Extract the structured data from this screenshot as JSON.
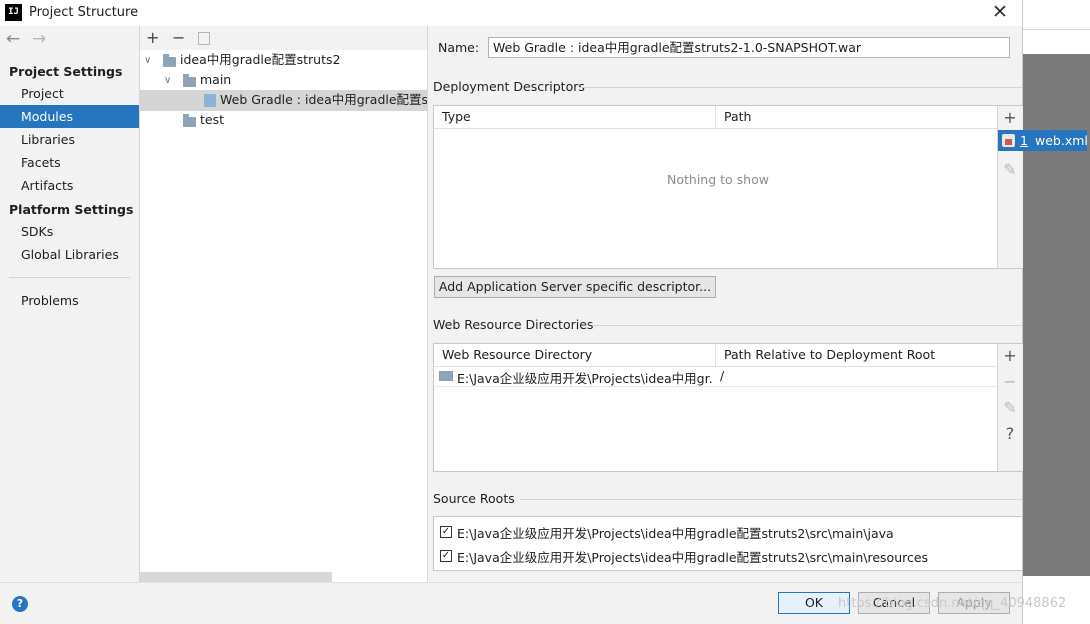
{
  "window": {
    "title": "Project Structure",
    "logo": "IJ"
  },
  "nav": {
    "back_icon": "arrow-left-icon",
    "forward_icon": "arrow-right-icon",
    "project_settings_header": "Project Settings",
    "project_items": [
      "Project",
      "Modules",
      "Libraries",
      "Facets",
      "Artifacts"
    ],
    "platform_settings_header": "Platform Settings",
    "platform_items": [
      "SDKs",
      "Global Libraries"
    ],
    "problems": "Problems",
    "selected": "Modules"
  },
  "tree": {
    "toolbar": {
      "add": "+",
      "remove": "−"
    },
    "root": "idea中用gradle配置struts2",
    "main": "main",
    "facet": "Web Gradle : idea中用gradle配置str",
    "test": "test"
  },
  "detail": {
    "name_label": "Name:",
    "name_value": "Web Gradle : idea中用gradle配置struts2-1.0-SNAPSHOT.war",
    "deployment_descriptors": {
      "header": "Deployment Descriptors",
      "columns": [
        "Type",
        "Path"
      ],
      "empty_text": "Nothing to show",
      "add_button": "Add Application Server specific descriptor..."
    },
    "popup": {
      "number": "1",
      "label": "web.xml"
    },
    "web_resource": {
      "header": "Web Resource Directories",
      "columns": [
        "Web Resource Directory",
        "Path Relative to Deployment Root"
      ],
      "rows": [
        {
          "dir": "E:\\Java企业级应用开发\\Projects\\idea中用gr...",
          "path": "/"
        }
      ],
      "help": "?"
    },
    "source_roots": {
      "header": "Source Roots",
      "items": [
        "E:\\Java企业级应用开发\\Projects\\idea中用gradle配置struts2\\src\\main\\java",
        "E:\\Java企业级应用开发\\Projects\\idea中用gradle配置struts2\\src\\main\\resources"
      ]
    }
  },
  "footer": {
    "ok": "OK",
    "cancel": "Cancel",
    "apply": "Apply",
    "help": "?",
    "watermark": "https://blog.csdn.net/qq_40948862"
  }
}
